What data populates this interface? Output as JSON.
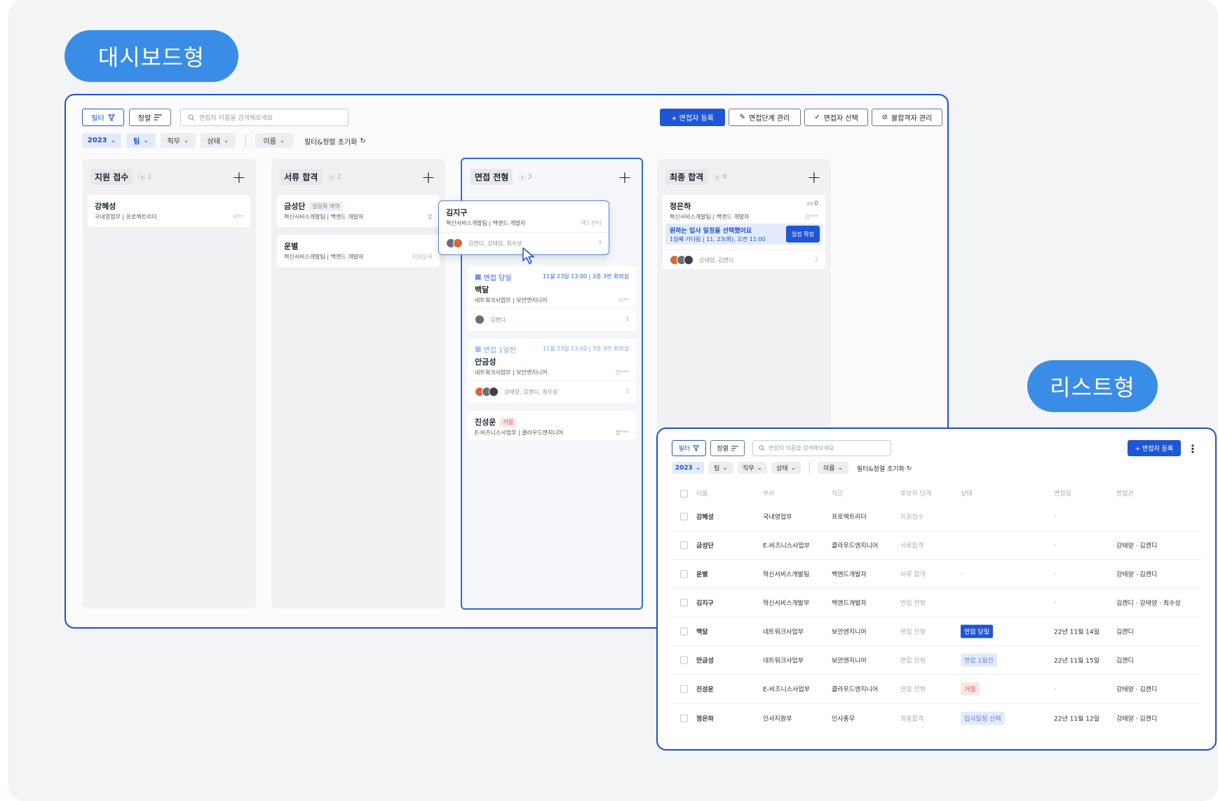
{
  "labels": {
    "dashboard": "대시보드형",
    "list": "리스트형"
  },
  "dashboard": {
    "toolbar": {
      "filter": "필터",
      "sort": "정렬",
      "search_placeholder": "면접자 이름을 검색해보세요",
      "add": "+ 면접자 등록",
      "stage_manage": "면접단계 관리",
      "select": "면접자 선택",
      "reject_manage": "불합격자 관리"
    },
    "filters": {
      "year": "2023",
      "team": "팀",
      "job": "직무",
      "status": "상태",
      "name": "이름",
      "reset": "필터&정렬 초기화"
    },
    "columns": [
      {
        "name": "지원 접수",
        "count": "1"
      },
      {
        "name": "서류 합격",
        "count": "2"
      },
      {
        "name": "면접 전형",
        "count": "3"
      },
      {
        "name": "최종 합격",
        "count": "0"
      }
    ],
    "cards": {
      "c1": {
        "name": "강혜성",
        "dept": "국내영업부 | 프로젝트리더",
        "mask": "시**"
      },
      "c2a": {
        "name": "금성단",
        "tag": "알림톡 예약",
        "dept": "혁신서비스개발팀 | 백엔드 개발자",
        "mask": "불"
      },
      "c2b": {
        "name": "운별",
        "dept": "혁신서비스개발팀 | 백엔드 개발자",
        "mask": "지원등록"
      },
      "drag": {
        "name": "김지구",
        "dept": "혁신서비스개발팀 | 백엔드 개발자",
        "mask": "헤드헌터",
        "people": "김캔디, 강태양, 최수성",
        "count": "3"
      },
      "c3a": {
        "label": "면접 당일",
        "date": "11월 23일 13:00 | 3층 3번 회의실",
        "name": "백달",
        "dept": "네트워크사업부 | 보안엔지니어",
        "mask": "시**",
        "people": "김캔디",
        "count": "1"
      },
      "c3b": {
        "label": "면접 1일전",
        "date": "11월 23일 13:00 | 3층 3번 회의실",
        "name": "안금성",
        "dept": "네트워크사업부 | 보안엔지니어",
        "mask": "인***",
        "people": "강태양, 김캔디, 최수성",
        "count": "3"
      },
      "c3c": {
        "name": "진성운",
        "tag": "거절",
        "dept": "E-비즈니스사업부 | 클라우드엔지니어",
        "mask": "불***"
      },
      "c4": {
        "name": "정은하",
        "memo": "0",
        "dept": "혁신서비스개발팀 | 백엔드 개발자",
        "mask": "김***",
        "notice": "원하는 입사 일정을 선택했어요",
        "notice_sub": "1일째 기다림 | 11. 23(화), 오전 11:00",
        "confirm": "일정 확정",
        "people": "강태양, 김캔디",
        "count": "2"
      }
    }
  },
  "list": {
    "toolbar": {
      "filter": "필터",
      "sort": "정렬",
      "search_placeholder": "면접자 이름을 검색해보세요",
      "add": "+ 면접자 등록"
    },
    "filters": {
      "year": "2023",
      "team": "팀",
      "job": "직무",
      "status": "상태",
      "name": "이름",
      "reset": "필터&정렬 초기화"
    },
    "headers": {
      "name": "이름",
      "dept": "부서",
      "job": "직군",
      "stage": "후보자 단계",
      "status": "상태",
      "date": "면접일",
      "interviewer": "면접관"
    },
    "rows": [
      {
        "name": "강혜성",
        "dept": "국내영업부",
        "job": "프로젝트리더",
        "stage": "지원접수",
        "status": "",
        "date": "-",
        "interviewer": ""
      },
      {
        "name": "금성단",
        "dept": "E-비즈니스사업부",
        "job": "클라우드엔지니어",
        "stage": "서류합격",
        "status": "",
        "date": "-",
        "interviewer": "강태양 · 김캔디"
      },
      {
        "name": "운별",
        "dept": "혁신서비스개발팀",
        "job": "백엔드개발자",
        "stage": "서류 합격",
        "status": "-",
        "date": "-",
        "interviewer": "강태양 · 김캔디"
      },
      {
        "name": "김지구",
        "dept": "혁신서비스개발부",
        "job": "백엔드개발자",
        "stage": "면접 전형",
        "status": "",
        "date": "-",
        "interviewer": "김캔디 · 강태양 · 최수성"
      },
      {
        "name": "백달",
        "dept": "네트워크사업부",
        "job": "보안엔지니어",
        "stage": "면접 전형",
        "status": "면접 당일",
        "date": "22년 11월 14일",
        "interviewer": "김캔디"
      },
      {
        "name": "안금성",
        "dept": "네트워크사업부",
        "job": "보안엔지니어",
        "stage": "면접 전형",
        "status": "면접 1일전",
        "date": "22년 11월 15일",
        "interviewer": "김캔디"
      },
      {
        "name": "진성운",
        "dept": "E-비즈니스사업부",
        "job": "클라우드엔지니어",
        "stage": "면접 전형",
        "status": "거절",
        "date": "-",
        "interviewer": "강태양 · 김캔디"
      },
      {
        "name": "정은하",
        "dept": "인사지원부",
        "job": "인사총무",
        "stage": "최종합격",
        "status": "입사일정 선택",
        "date": "22년 11월 12일",
        "interviewer": "강태양 · 김캔디"
      }
    ]
  },
  "colors": {
    "accent": "#1f56d6",
    "label_pill": "#3a8de6",
    "panel_border": "#1f4fcb",
    "rejected": "#e25656"
  }
}
